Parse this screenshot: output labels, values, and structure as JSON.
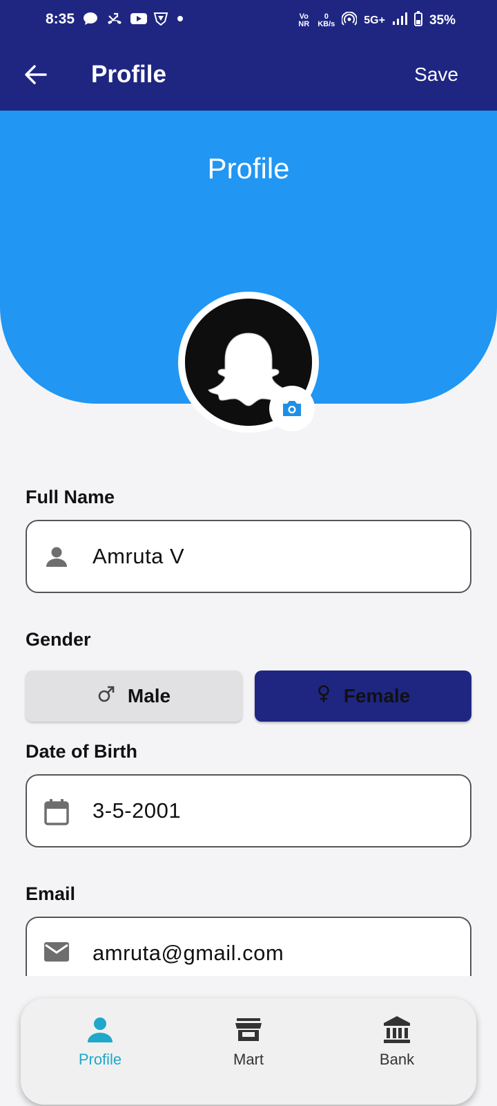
{
  "status_bar": {
    "time": "8:35",
    "network_speed_value": "0",
    "network_speed_unit": "KB/s",
    "volte": "Vo NR",
    "signal": "5G+",
    "battery": "35%"
  },
  "app_bar": {
    "title": "Profile",
    "save_label": "Save"
  },
  "header": {
    "heading": "Profile"
  },
  "form": {
    "full_name": {
      "label": "Full Name",
      "value": "Amruta V",
      "icon": "person-icon"
    },
    "gender": {
      "label": "Gender",
      "options": [
        "Male",
        "Female"
      ],
      "selected": "Female"
    },
    "dob": {
      "label": "Date of Birth",
      "value": "3-5-2001",
      "icon": "calendar-icon"
    },
    "email": {
      "label": "Email",
      "value": "amruta@gmail.com",
      "icon": "mail-icon"
    }
  },
  "bottom_nav": {
    "items": [
      {
        "label": "Profile",
        "icon": "person-icon",
        "active": true
      },
      {
        "label": "Mart",
        "icon": "store-icon",
        "active": false
      },
      {
        "label": "Bank",
        "icon": "bank-icon",
        "active": false
      }
    ]
  },
  "colors": {
    "app_bar": "#1f2682",
    "hero": "#2196f3",
    "nav_active": "#1fa8c9",
    "female_selected": "#1f2682",
    "male_unselected": "#e1e1e3"
  }
}
